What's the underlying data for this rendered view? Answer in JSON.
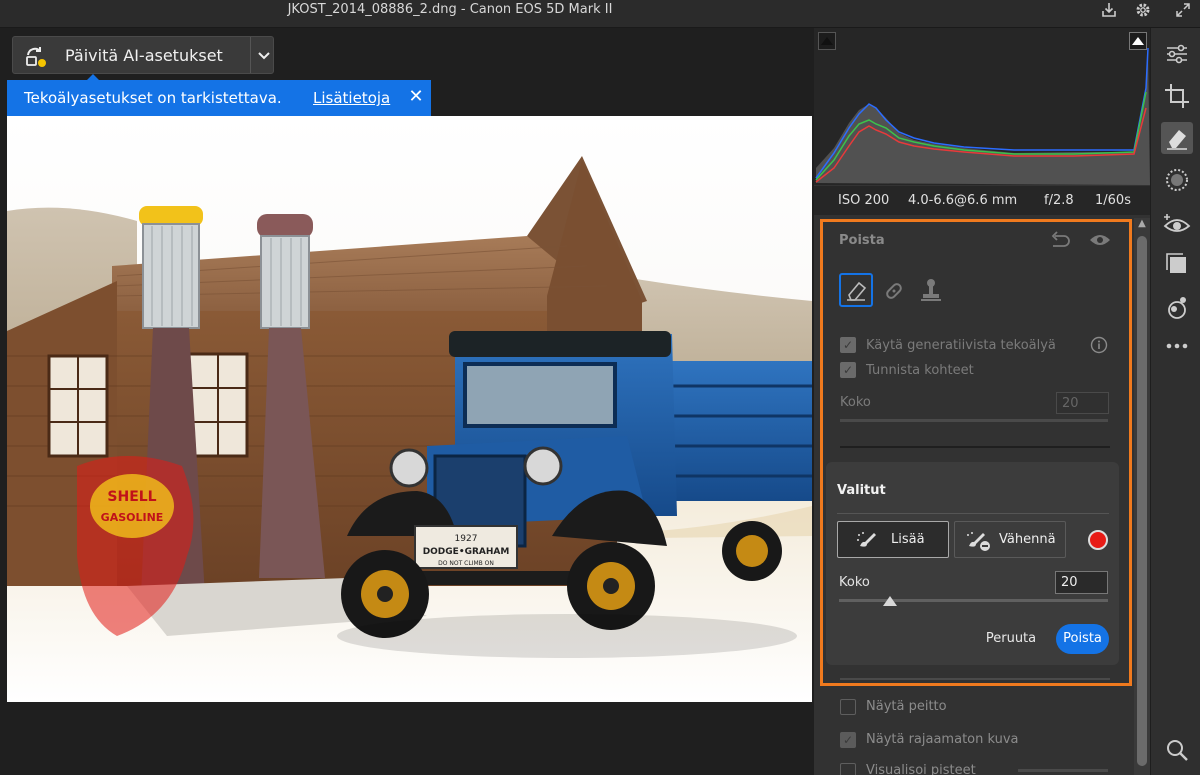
{
  "window": {
    "title": "JKOST_2014_08886_2.dng  -  Canon EOS 5D Mark II"
  },
  "ai_update": {
    "label": "Päivitä AI-asetukset"
  },
  "notification": {
    "message": "Tekoälyasetukset on tarkistettava.",
    "link": "Lisätietoja"
  },
  "exif": {
    "iso": "ISO 200",
    "focal": "4.0-6.6@6.6 mm",
    "aperture": "f/2.8",
    "shutter": "1/60s"
  },
  "photo": {
    "sign_line1": "SHELL",
    "sign_line2": "GASOLINE",
    "plate_year": "1927",
    "plate_name": "DODGE•GRAHAM",
    "plate_note": "DO NOT CLIMB ON"
  },
  "remove_panel": {
    "title": "Poista",
    "use_generative_ai": "Käytä generatiivista tekoälyä",
    "detect_objects": "Tunnista kohteet",
    "size_label": "Koko",
    "size_value": "20"
  },
  "selected": {
    "title": "Valitut",
    "add_label": "Lisää",
    "subtract_label": "Vähennä",
    "size_label": "Koko",
    "size_value": "20",
    "size_fraction": 0.19,
    "brush_color": "#e81b16",
    "cancel_label": "Peruuta",
    "apply_label": "Poista"
  },
  "options": {
    "show_overlay": "Näytä peitto",
    "show_uncropped": "Näytä rajaamaton kuva",
    "visualize_spots": "Visualisoi pisteet"
  },
  "colors": {
    "accent": "#1473e6",
    "highlight": "#f07a1e"
  }
}
